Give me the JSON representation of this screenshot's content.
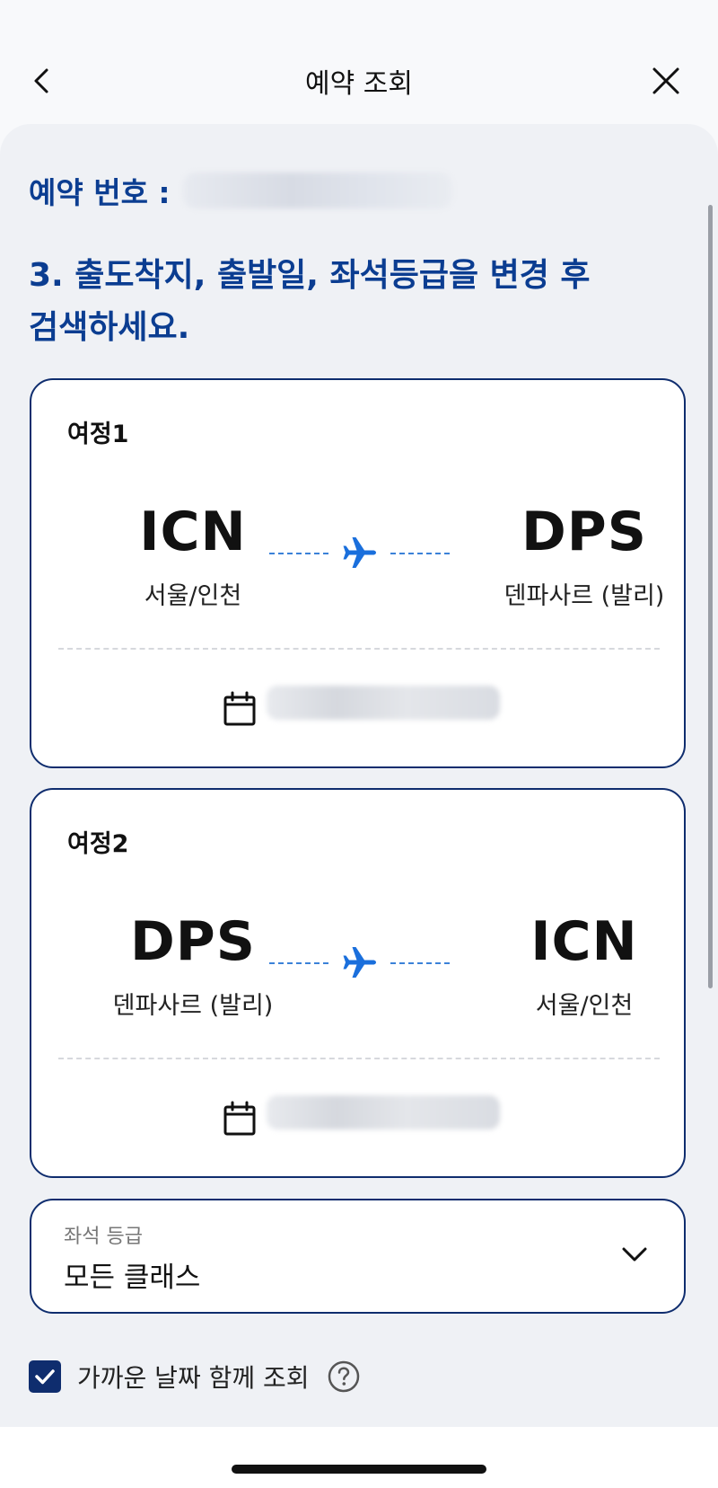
{
  "header": {
    "title": "예약 조회",
    "back_icon": "chevron-left-icon",
    "close_icon": "close-icon"
  },
  "booking": {
    "label": "예약 번호 :"
  },
  "instruction": {
    "line1": "3. 출도착지, 출발일, 좌석등급을 변경 후",
    "line2": "검색하세요."
  },
  "itineraries": [
    {
      "label": "여정1",
      "from_code": "ICN",
      "from_city": "서울/인천",
      "to_code": "DPS",
      "to_city": "덴파사르 (발리)"
    },
    {
      "label": "여정2",
      "from_code": "DPS",
      "from_city": "덴파사르 (발리)",
      "to_code": "ICN",
      "to_city": "서울/인천"
    }
  ],
  "seat_class": {
    "label": "좌석 등급",
    "value": "모든 클래스"
  },
  "nearby_dates": {
    "checked": true,
    "label": "가까운 날짜 함께 조회"
  },
  "colors": {
    "brand_navy": "#0b3d91",
    "border_navy": "#0f2d6e",
    "plane_blue": "#1a6fdc",
    "background": "#eff1f5"
  }
}
